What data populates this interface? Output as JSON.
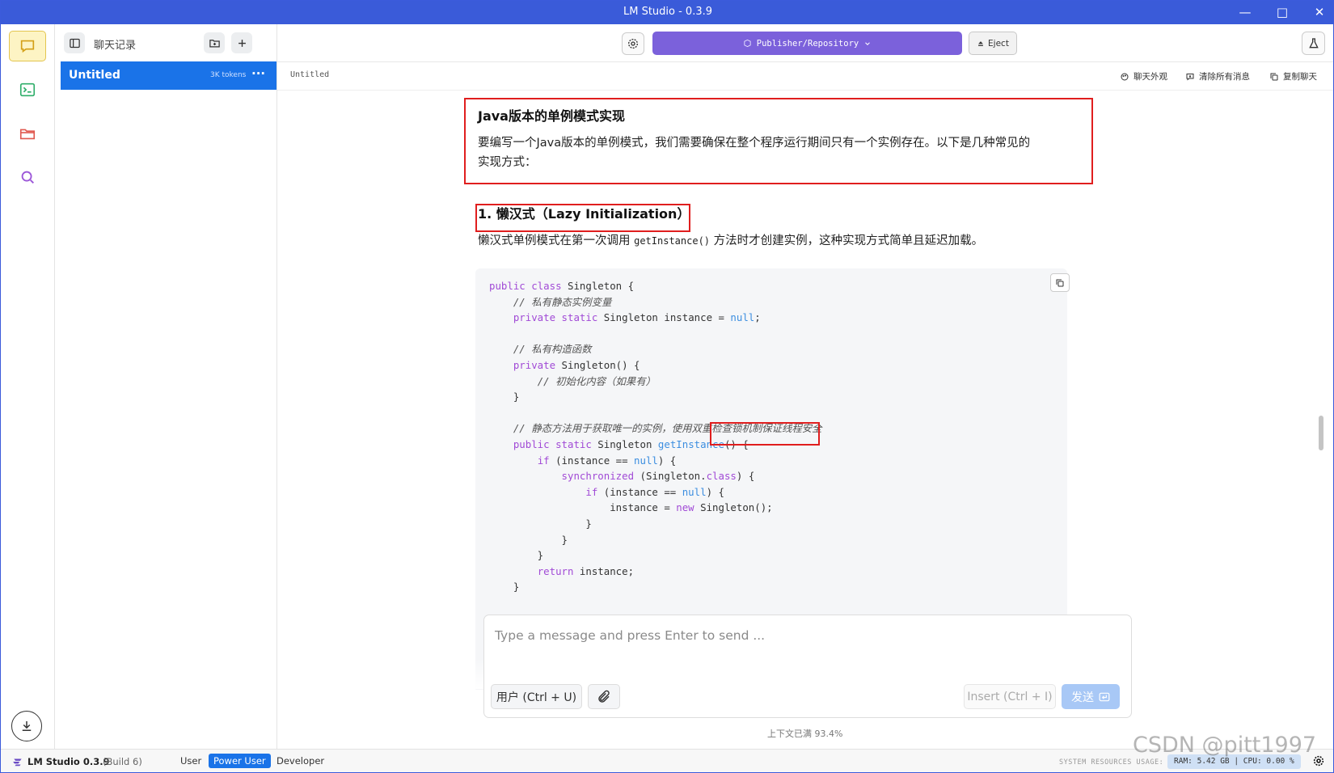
{
  "window": {
    "title": "LM Studio - 0.3.9",
    "minimize": "—",
    "maximize": "□",
    "close": "✕"
  },
  "sidebar": {
    "title": "聊天记录",
    "chats": [
      {
        "name": "Untitled",
        "tokens": "3K tokens",
        "more": "···"
      }
    ]
  },
  "topbar": {
    "model_label": "Publisher/Repository",
    "eject_label": "Eject"
  },
  "subbar": {
    "breadcrumb": "Untitled",
    "actions": [
      "聊天外观",
      "清除所有消息",
      "复制聊天"
    ]
  },
  "message": {
    "heading": "Java版本的单例模式实现",
    "intro_line1": "要编写一个Java版本的单例模式，我们需要确保在整个程序运行期间只有一个实例存在。以下是几种常见的",
    "intro_line2": "实现方式：",
    "section_heading": "1. 懒汉式（Lazy Initialization）",
    "section_text_before": "懒汉式单例模式在第一次调用 ",
    "section_code": "getInstance()",
    "section_text_after": " 方法时才创建实例，这种实现方式简单且延迟加载。",
    "code_lines": [
      "public class Singleton {",
      "    // 私有静态实例变量",
      "    private static Singleton instance = null;",
      "",
      "    // 私有构造函数",
      "    private Singleton() {",
      "        // 初始化内容（如果有）",
      "    }",
      "",
      "    // 静态方法用于获取唯一的实例，使用双重检查锁机制保证线程安全",
      "    public static Singleton getInstance() {",
      "        if (instance == null) {",
      "            synchronized (Singleton.class) {",
      "                if (instance == null) {",
      "                    instance = new Singleton();",
      "                }",
      "            }",
      "        }",
      "        return instance;",
      "    }"
    ]
  },
  "input": {
    "placeholder": "Type a message and press Enter to send ...",
    "role_button": "用户 (Ctrl + U)",
    "insert_button": "Insert (Ctrl + I)",
    "send_button": "发送",
    "context_usage": "上下文已满 93.4%"
  },
  "statusbar": {
    "app_name": "LM Studio 0.3.9",
    "build": "(Build 6)",
    "modes": [
      "User",
      "Power User",
      "Developer"
    ],
    "active_mode": "Power User",
    "system_resources_label": "SYSTEM RESOURCES USAGE:",
    "resources": "RAM: 5.42 GB | CPU: 0.00 %"
  },
  "watermark": "CSDN @pitt1997",
  "colors": {
    "titlebar": "#3a5bd9",
    "model_button": "#7b61db",
    "active_chat": "#1a73e8",
    "highlight_box": "#e01e1e",
    "active_rail": "#fdf4c4"
  }
}
